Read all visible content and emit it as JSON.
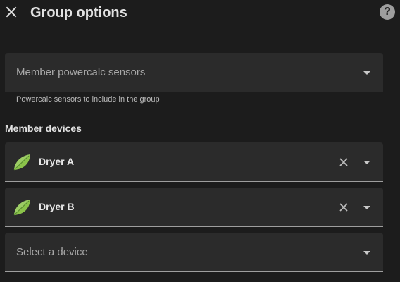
{
  "dialog": {
    "title": "Group options",
    "close_icon": "close-icon",
    "help_icon": "help-circle-icon",
    "help_symbol": "?"
  },
  "member_powercalc_sensors": {
    "placeholder": "Member powercalc sensors",
    "helper": "Powercalc sensors to include in the group"
  },
  "member_devices": {
    "label": "Member devices",
    "devices": [
      {
        "name": "Dryer A",
        "icon": "leaf-icon"
      },
      {
        "name": "Dryer B",
        "icon": "leaf-icon"
      }
    ],
    "add_placeholder": "Select a device"
  },
  "colors": {
    "background": "#1c1c1c",
    "field_background": "#2b2b2b",
    "leaf_green": "#7cb342"
  }
}
